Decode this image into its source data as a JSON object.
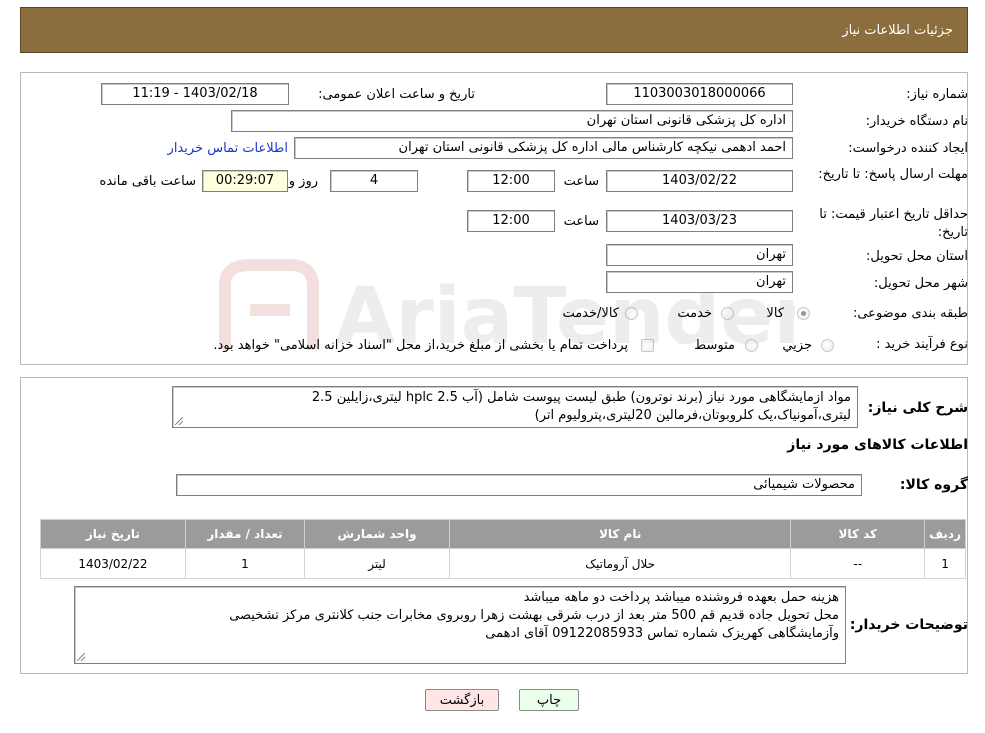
{
  "header": {
    "title": "جزئیات اطلاعات نیاز"
  },
  "fields": {
    "need_number": {
      "label": "شماره نیاز:",
      "value": "1103003018000066"
    },
    "announce_datetime": {
      "label": "تاریخ و ساعت اعلان عمومی:",
      "value": "1403/02/18 - 11:19"
    },
    "buyer_org": {
      "label": "نام دستگاه خریدار:",
      "value": "اداره کل پزشکی قانونی استان تهران"
    },
    "requester": {
      "label": "ایجاد کننده درخواست:",
      "value": "احمد ادهمی نیکچه کارشناس مالی اداره کل پزشکی قانونی استان تهران",
      "contact_link": "اطلاعات تماس خریدار"
    },
    "deadline": {
      "label": "مهلت ارسال پاسخ: تا تاریخ:",
      "date": "1403/02/22",
      "time_label": "ساعت",
      "time": "12:00",
      "days": "4",
      "days_label": "روز و",
      "remaining": "00:29:07",
      "remaining_label": "ساعت باقی مانده"
    },
    "validity": {
      "label": "حداقل تاریخ اعتبار قیمت: تا تاریخ:",
      "date": "1403/03/23",
      "time_label": "ساعت",
      "time": "12:00"
    },
    "province": {
      "label": "استان محل تحویل:",
      "value": "تهران"
    },
    "city": {
      "label": "شهر محل تحویل:",
      "value": "تهران"
    },
    "category": {
      "label": "طبقه بندی موضوعی:",
      "options": [
        "کالا",
        "خدمت",
        "کالا/خدمت"
      ],
      "selected": "کالا"
    },
    "purchase_type": {
      "label": "نوع فرآیند خرید :",
      "options": [
        "جزیي",
        "متوسط"
      ],
      "note": "پرداخت تمام یا بخشی از مبلغ خرید،از محل \"اسناد خزانه اسلامی\" خواهد بود."
    }
  },
  "description": {
    "label": "شرح کلی نیاز:",
    "text_line1": "مواد ازمایشگاهی مورد نیاز (برند نوترون)  طبق لیست پیوست شامل (آب hplc 2.5 لیتری،زایلین 2.5",
    "text_line2": "لیتری،آمونیاک،یک کلروبوتان،فرمالین 20لیتری،پترولیوم اتر)"
  },
  "goods_section": {
    "title": "اطلاعات کالاهای مورد نیاز",
    "group_label": "گروه کالا:",
    "group_value": "محصولات شیمیائی"
  },
  "table": {
    "headers": [
      "ردیف",
      "کد کالا",
      "نام کالا",
      "واحد شمارش",
      "تعداد / مقدار",
      "تاریخ نیاز"
    ],
    "rows": [
      [
        "1",
        "--",
        "حلال آروماتیک",
        "لیتر",
        "1",
        "1403/02/22"
      ]
    ]
  },
  "buyer_notes": {
    "label": "توضیحات خریدار:",
    "line1": "هزینه حمل بعهده فروشنده میباشد پرداخت دو ماهه میباشد",
    "line2": "محل تحویل جاده قدیم قم 500 متر بعد از درب شرقی بهشت زهرا روبروی مخابرات جنب کلانتری مرکز تشخیصی",
    "line3": "وآزمایشگاهی کهریزک شماره تماس 09122085933 آقای ادهمی"
  },
  "buttons": {
    "print": "چاپ",
    "back": "بازگشت"
  },
  "colors": {
    "header_bg": "#8b6d3e",
    "table_header_bg": "#9b9b9b",
    "link": "#1a37c9"
  }
}
